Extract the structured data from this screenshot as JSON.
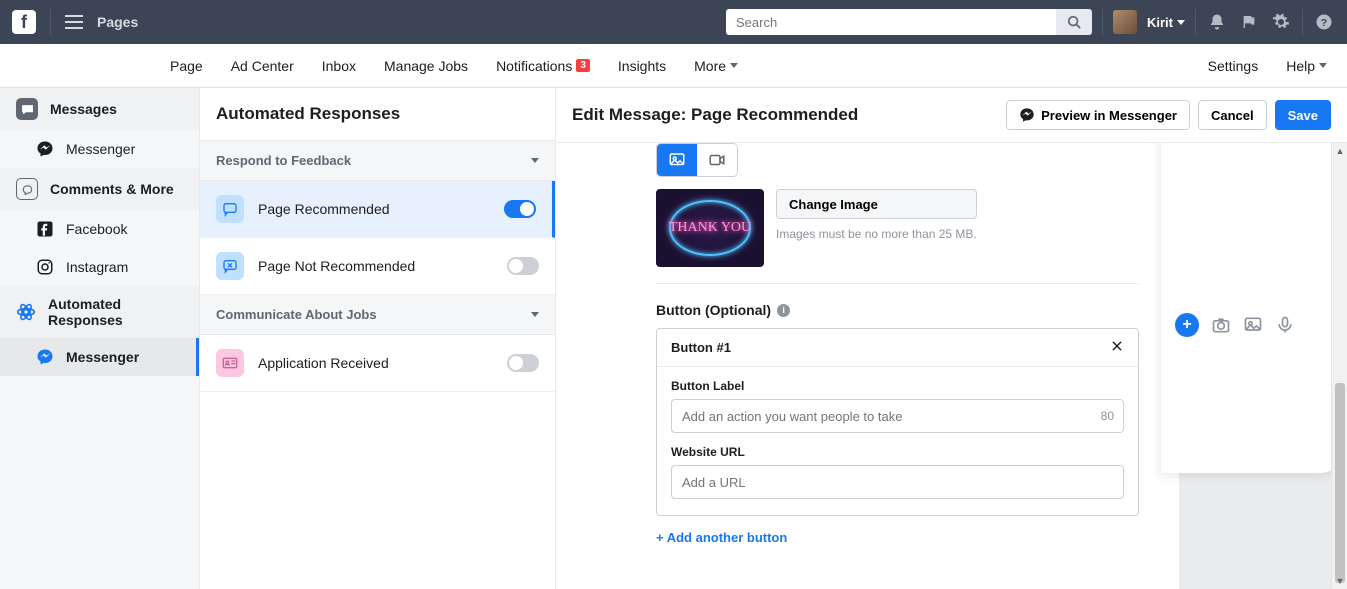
{
  "topbar": {
    "app": "Pages",
    "search_placeholder": "Search",
    "user": "Kirit"
  },
  "subnav": {
    "items": [
      "Page",
      "Ad Center",
      "Inbox",
      "Manage Jobs",
      "Notifications",
      "Insights",
      "More"
    ],
    "notif_badge": "3",
    "right": [
      "Settings",
      "Help"
    ]
  },
  "sidebar": {
    "messages": "Messages",
    "messenger": "Messenger",
    "comments": "Comments & More",
    "facebook": "Facebook",
    "instagram": "Instagram",
    "automated": "Automated Responses",
    "messenger2": "Messenger"
  },
  "mid": {
    "title": "Automated Responses",
    "section1": "Respond to Feedback",
    "row1": "Page Recommended",
    "row2": "Page Not Recommended",
    "section2": "Communicate About Jobs",
    "row3": "Application Received",
    "toggles": {
      "page_recommended": true,
      "page_not_recommended": false,
      "application_received": false
    }
  },
  "editor": {
    "title": "Edit Message: Page Recommended",
    "preview_btn": "Preview in Messenger",
    "cancel_btn": "Cancel",
    "save_btn": "Save",
    "change_image_btn": "Change Image",
    "image_hint": "Images must be no more than 25 MB.",
    "thumb_text": "THANK YOU",
    "button_section_label": "Button (Optional)",
    "button1_title": "Button #1",
    "button_label_field": "Button Label",
    "button_label_placeholder": "Add an action you want people to take",
    "button_label_counter": "80",
    "url_field": "Website URL",
    "url_placeholder": "Add a URL",
    "add_another": "+ Add another button"
  }
}
